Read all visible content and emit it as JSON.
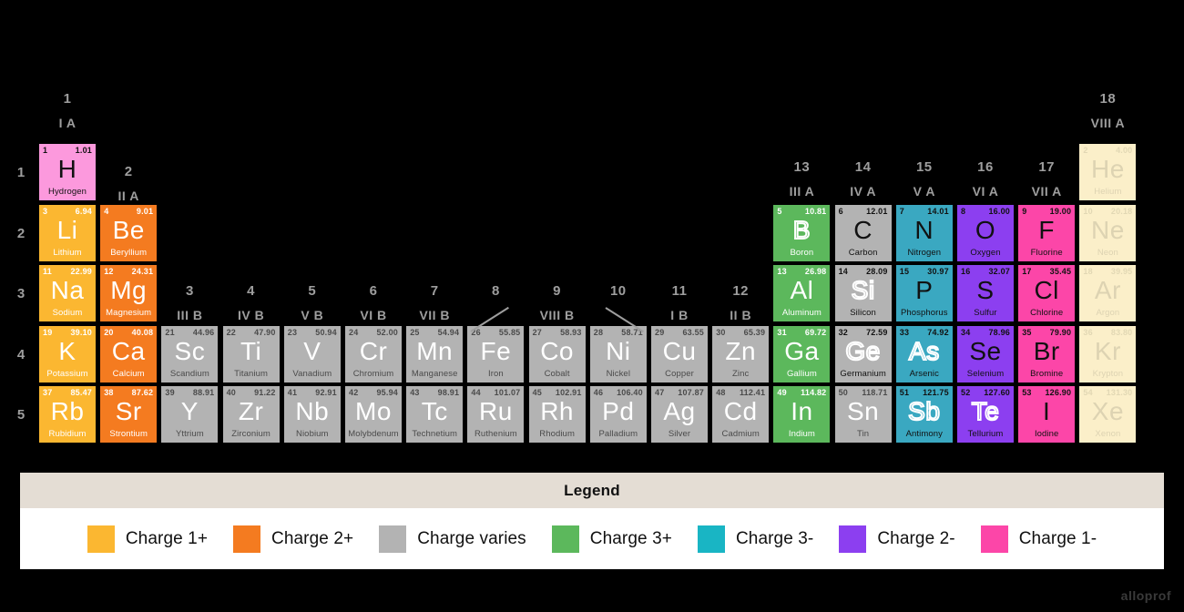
{
  "colors": {
    "background": "#000000",
    "charge_1p": "#fbb731",
    "charge_2p": "#f47b20",
    "charge_varies": "#b3b3b3",
    "charge_3p": "#5cb85c",
    "charge_3m": "#19b5c4",
    "charge_2m": "#8c3ff0",
    "charge_1m": "#fc46a8",
    "noble": "#fbefc9",
    "label": "#9e9e9e",
    "legend_header_bg": "#e4ddd4",
    "legend_body_bg": "#ffffff"
  },
  "groups": [
    {
      "num": "1",
      "roman": "I A",
      "col": 1
    },
    {
      "num": "2",
      "roman": "II A",
      "col": 2
    },
    {
      "num": "3",
      "roman": "III B",
      "col": 3
    },
    {
      "num": "4",
      "roman": "IV B",
      "col": 4
    },
    {
      "num": "5",
      "roman": "V B",
      "col": 5
    },
    {
      "num": "6",
      "roman": "VI B",
      "col": 6
    },
    {
      "num": "7",
      "roman": "VII B",
      "col": 7
    },
    {
      "num": "8",
      "roman": "",
      "col": 8
    },
    {
      "num": "9",
      "roman": "",
      "col": 9
    },
    {
      "num": "10",
      "roman": "",
      "col": 10
    },
    {
      "num": "11",
      "roman": "I B",
      "col": 11
    },
    {
      "num": "12",
      "roman": "II B",
      "col": 12
    },
    {
      "num": "13",
      "roman": "III A",
      "col": 13
    },
    {
      "num": "14",
      "roman": "IV A",
      "col": 14
    },
    {
      "num": "15",
      "roman": "V A",
      "col": 15
    },
    {
      "num": "16",
      "roman": "VI A",
      "col": 16
    },
    {
      "num": "17",
      "roman": "VII A",
      "col": 17
    },
    {
      "num": "18",
      "roman": "VIII A",
      "col": 18
    }
  ],
  "viii_b_label": "VIII B",
  "periods": [
    "1",
    "2",
    "3",
    "4",
    "5"
  ],
  "elements": [
    {
      "z": "1",
      "sym": "H",
      "name": "Hydrogen",
      "mass": "1.01",
      "col": 1,
      "row": 1,
      "fill": "#fc99dd",
      "text": "dark",
      "outline": false
    },
    {
      "z": "2",
      "sym": "He",
      "name": "Helium",
      "mass": "4.00",
      "col": 18,
      "row": 1,
      "fill": "#fbefc9",
      "text": "faded",
      "outline": false
    },
    {
      "z": "3",
      "sym": "Li",
      "name": "Lithium",
      "mass": "6.94",
      "col": 1,
      "row": 2,
      "fill": "#fbb731",
      "text": "light",
      "outline": false
    },
    {
      "z": "4",
      "sym": "Be",
      "name": "Beryllium",
      "mass": "9.01",
      "col": 2,
      "row": 2,
      "fill": "#f47b20",
      "text": "light",
      "outline": false
    },
    {
      "z": "5",
      "sym": "B",
      "name": "Boron",
      "mass": "10.81",
      "col": 13,
      "row": 2,
      "fill": "#5cb85c",
      "text": "light",
      "outline": true
    },
    {
      "z": "6",
      "sym": "C",
      "name": "Carbon",
      "mass": "12.01",
      "col": 14,
      "row": 2,
      "fill": "#b3b3b3",
      "text": "dark",
      "outline": false
    },
    {
      "z": "7",
      "sym": "N",
      "name": "Nitrogen",
      "mass": "14.01",
      "col": 15,
      "row": 2,
      "fill": "#3aa8c1",
      "text": "dark",
      "outline": false
    },
    {
      "z": "8",
      "sym": "O",
      "name": "Oxygen",
      "mass": "16.00",
      "col": 16,
      "row": 2,
      "fill": "#8c3ff0",
      "text": "dark",
      "outline": false
    },
    {
      "z": "9",
      "sym": "F",
      "name": "Fluorine",
      "mass": "19.00",
      "col": 17,
      "row": 2,
      "fill": "#fc46a8",
      "text": "dark",
      "outline": false
    },
    {
      "z": "10",
      "sym": "Ne",
      "name": "Neon",
      "mass": "20.18",
      "col": 18,
      "row": 2,
      "fill": "#fbefc9",
      "text": "faded",
      "outline": false
    },
    {
      "z": "11",
      "sym": "Na",
      "name": "Sodium",
      "mass": "22.99",
      "col": 1,
      "row": 3,
      "fill": "#fbb731",
      "text": "light",
      "outline": false
    },
    {
      "z": "12",
      "sym": "Mg",
      "name": "Magnesium",
      "mass": "24.31",
      "col": 2,
      "row": 3,
      "fill": "#f47b20",
      "text": "light",
      "outline": false
    },
    {
      "z": "13",
      "sym": "Al",
      "name": "Aluminum",
      "mass": "26.98",
      "col": 13,
      "row": 3,
      "fill": "#5cb85c",
      "text": "light",
      "outline": false
    },
    {
      "z": "14",
      "sym": "Si",
      "name": "Silicon",
      "mass": "28.09",
      "col": 14,
      "row": 3,
      "fill": "#b3b3b3",
      "text": "dark",
      "outline": true
    },
    {
      "z": "15",
      "sym": "P",
      "name": "Phosphorus",
      "mass": "30.97",
      "col": 15,
      "row": 3,
      "fill": "#3aa8c1",
      "text": "dark",
      "outline": false
    },
    {
      "z": "16",
      "sym": "S",
      "name": "Sulfur",
      "mass": "32.07",
      "col": 16,
      "row": 3,
      "fill": "#8c3ff0",
      "text": "dark",
      "outline": false
    },
    {
      "z": "17",
      "sym": "Cl",
      "name": "Chlorine",
      "mass": "35.45",
      "col": 17,
      "row": 3,
      "fill": "#fc46a8",
      "text": "dark",
      "outline": false
    },
    {
      "z": "18",
      "sym": "Ar",
      "name": "Argon",
      "mass": "39.95",
      "col": 18,
      "row": 3,
      "fill": "#fbefc9",
      "text": "faded",
      "outline": false
    },
    {
      "z": "19",
      "sym": "K",
      "name": "Potassium",
      "mass": "39.10",
      "col": 1,
      "row": 4,
      "fill": "#fbb731",
      "text": "light",
      "outline": false
    },
    {
      "z": "20",
      "sym": "Ca",
      "name": "Calcium",
      "mass": "40.08",
      "col": 2,
      "row": 4,
      "fill": "#f47b20",
      "text": "light",
      "outline": false
    },
    {
      "z": "21",
      "sym": "Sc",
      "name": "Scandium",
      "mass": "44.96",
      "col": 3,
      "row": 4,
      "fill": "#b3b3b3",
      "text": "gray",
      "outline": false
    },
    {
      "z": "22",
      "sym": "Ti",
      "name": "Titanium",
      "mass": "47.90",
      "col": 4,
      "row": 4,
      "fill": "#b3b3b3",
      "text": "gray",
      "outline": false
    },
    {
      "z": "23",
      "sym": "V",
      "name": "Vanadium",
      "mass": "50.94",
      "col": 5,
      "row": 4,
      "fill": "#b3b3b3",
      "text": "gray",
      "outline": false
    },
    {
      "z": "24",
      "sym": "Cr",
      "name": "Chromium",
      "mass": "52.00",
      "col": 6,
      "row": 4,
      "fill": "#b3b3b3",
      "text": "gray",
      "outline": false
    },
    {
      "z": "25",
      "sym": "Mn",
      "name": "Manganese",
      "mass": "54.94",
      "col": 7,
      "row": 4,
      "fill": "#b3b3b3",
      "text": "gray",
      "outline": false
    },
    {
      "z": "26",
      "sym": "Fe",
      "name": "Iron",
      "mass": "55.85",
      "col": 8,
      "row": 4,
      "fill": "#b3b3b3",
      "text": "gray",
      "outline": false
    },
    {
      "z": "27",
      "sym": "Co",
      "name": "Cobalt",
      "mass": "58.93",
      "col": 9,
      "row": 4,
      "fill": "#b3b3b3",
      "text": "gray",
      "outline": false
    },
    {
      "z": "28",
      "sym": "Ni",
      "name": "Nickel",
      "mass": "58.71",
      "col": 10,
      "row": 4,
      "fill": "#b3b3b3",
      "text": "gray",
      "outline": false
    },
    {
      "z": "29",
      "sym": "Cu",
      "name": "Copper",
      "mass": "63.55",
      "col": 11,
      "row": 4,
      "fill": "#b3b3b3",
      "text": "gray",
      "outline": false
    },
    {
      "z": "30",
      "sym": "Zn",
      "name": "Zinc",
      "mass": "65.39",
      "col": 12,
      "row": 4,
      "fill": "#b3b3b3",
      "text": "gray",
      "outline": false
    },
    {
      "z": "31",
      "sym": "Ga",
      "name": "Gallium",
      "mass": "69.72",
      "col": 13,
      "row": 4,
      "fill": "#5cb85c",
      "text": "light",
      "outline": false
    },
    {
      "z": "32",
      "sym": "Ge",
      "name": "Germanium",
      "mass": "72.59",
      "col": 14,
      "row": 4,
      "fill": "#b3b3b3",
      "text": "dark",
      "outline": true
    },
    {
      "z": "33",
      "sym": "As",
      "name": "Arsenic",
      "mass": "74.92",
      "col": 15,
      "row": 4,
      "fill": "#3aa8c1",
      "text": "dark",
      "outline": true
    },
    {
      "z": "34",
      "sym": "Se",
      "name": "Selenium",
      "mass": "78.96",
      "col": 16,
      "row": 4,
      "fill": "#8c3ff0",
      "text": "dark",
      "outline": false
    },
    {
      "z": "35",
      "sym": "Br",
      "name": "Bromine",
      "mass": "79.90",
      "col": 17,
      "row": 4,
      "fill": "#fc46a8",
      "text": "dark",
      "outline": false
    },
    {
      "z": "36",
      "sym": "Kr",
      "name": "Krypton",
      "mass": "83.80",
      "col": 18,
      "row": 4,
      "fill": "#fbefc9",
      "text": "faded",
      "outline": false
    },
    {
      "z": "37",
      "sym": "Rb",
      "name": "Rubidium",
      "mass": "85.47",
      "col": 1,
      "row": 5,
      "fill": "#fbb731",
      "text": "light",
      "outline": false
    },
    {
      "z": "38",
      "sym": "Sr",
      "name": "Strontium",
      "mass": "87.62",
      "col": 2,
      "row": 5,
      "fill": "#f47b20",
      "text": "light",
      "outline": false
    },
    {
      "z": "39",
      "sym": "Y",
      "name": "Yttrium",
      "mass": "88.91",
      "col": 3,
      "row": 5,
      "fill": "#b3b3b3",
      "text": "gray",
      "outline": false
    },
    {
      "z": "40",
      "sym": "Zr",
      "name": "Zirconium",
      "mass": "91.22",
      "col": 4,
      "row": 5,
      "fill": "#b3b3b3",
      "text": "gray",
      "outline": false
    },
    {
      "z": "41",
      "sym": "Nb",
      "name": "Niobium",
      "mass": "92.91",
      "col": 5,
      "row": 5,
      "fill": "#b3b3b3",
      "text": "gray",
      "outline": false
    },
    {
      "z": "42",
      "sym": "Mo",
      "name": "Molybdenum",
      "mass": "95.94",
      "col": 6,
      "row": 5,
      "fill": "#b3b3b3",
      "text": "gray",
      "outline": false
    },
    {
      "z": "43",
      "sym": "Tc",
      "name": "Technetium",
      "mass": "98.91",
      "col": 7,
      "row": 5,
      "fill": "#b3b3b3",
      "text": "gray",
      "outline": false
    },
    {
      "z": "44",
      "sym": "Ru",
      "name": "Ruthenium",
      "mass": "101.07",
      "col": 8,
      "row": 5,
      "fill": "#b3b3b3",
      "text": "gray",
      "outline": false
    },
    {
      "z": "45",
      "sym": "Rh",
      "name": "Rhodium",
      "mass": "102.91",
      "col": 9,
      "row": 5,
      "fill": "#b3b3b3",
      "text": "gray",
      "outline": false
    },
    {
      "z": "46",
      "sym": "Pd",
      "name": "Palladium",
      "mass": "106.40",
      "col": 10,
      "row": 5,
      "fill": "#b3b3b3",
      "text": "gray",
      "outline": false
    },
    {
      "z": "47",
      "sym": "Ag",
      "name": "Silver",
      "mass": "107.87",
      "col": 11,
      "row": 5,
      "fill": "#b3b3b3",
      "text": "gray",
      "outline": false
    },
    {
      "z": "48",
      "sym": "Cd",
      "name": "Cadmium",
      "mass": "112.41",
      "col": 12,
      "row": 5,
      "fill": "#b3b3b3",
      "text": "gray",
      "outline": false
    },
    {
      "z": "49",
      "sym": "In",
      "name": "Indium",
      "mass": "114.82",
      "col": 13,
      "row": 5,
      "fill": "#5cb85c",
      "text": "light",
      "outline": false
    },
    {
      "z": "50",
      "sym": "Sn",
      "name": "Tin",
      "mass": "118.71",
      "col": 14,
      "row": 5,
      "fill": "#b3b3b3",
      "text": "gray",
      "outline": false
    },
    {
      "z": "51",
      "sym": "Sb",
      "name": "Antimony",
      "mass": "121.75",
      "col": 15,
      "row": 5,
      "fill": "#3aa8c1",
      "text": "dark",
      "outline": true
    },
    {
      "z": "52",
      "sym": "Te",
      "name": "Tellurium",
      "mass": "127.60",
      "col": 16,
      "row": 5,
      "fill": "#8c3ff0",
      "text": "dark",
      "outline": true
    },
    {
      "z": "53",
      "sym": "I",
      "name": "Iodine",
      "mass": "126.90",
      "col": 17,
      "row": 5,
      "fill": "#fc46a8",
      "text": "dark",
      "outline": false
    },
    {
      "z": "54",
      "sym": "Xe",
      "name": "Xenon",
      "mass": "131.30",
      "col": 18,
      "row": 5,
      "fill": "#fbefc9",
      "text": "faded",
      "outline": false
    }
  ],
  "legend": {
    "title": "Legend",
    "items": [
      {
        "color": "#fbb731",
        "label": "Charge 1+"
      },
      {
        "color": "#f47b20",
        "label": "Charge 2+"
      },
      {
        "color": "#b3b3b3",
        "label": "Charge varies"
      },
      {
        "color": "#5cb85c",
        "label": "Charge 3+"
      },
      {
        "color": "#19b5c4",
        "label": "Charge 3-"
      },
      {
        "color": "#8c3ff0",
        "label": "Charge 2-"
      },
      {
        "color": "#fc46a8",
        "label": "Charge 1-"
      }
    ]
  },
  "watermark": "alloprof"
}
